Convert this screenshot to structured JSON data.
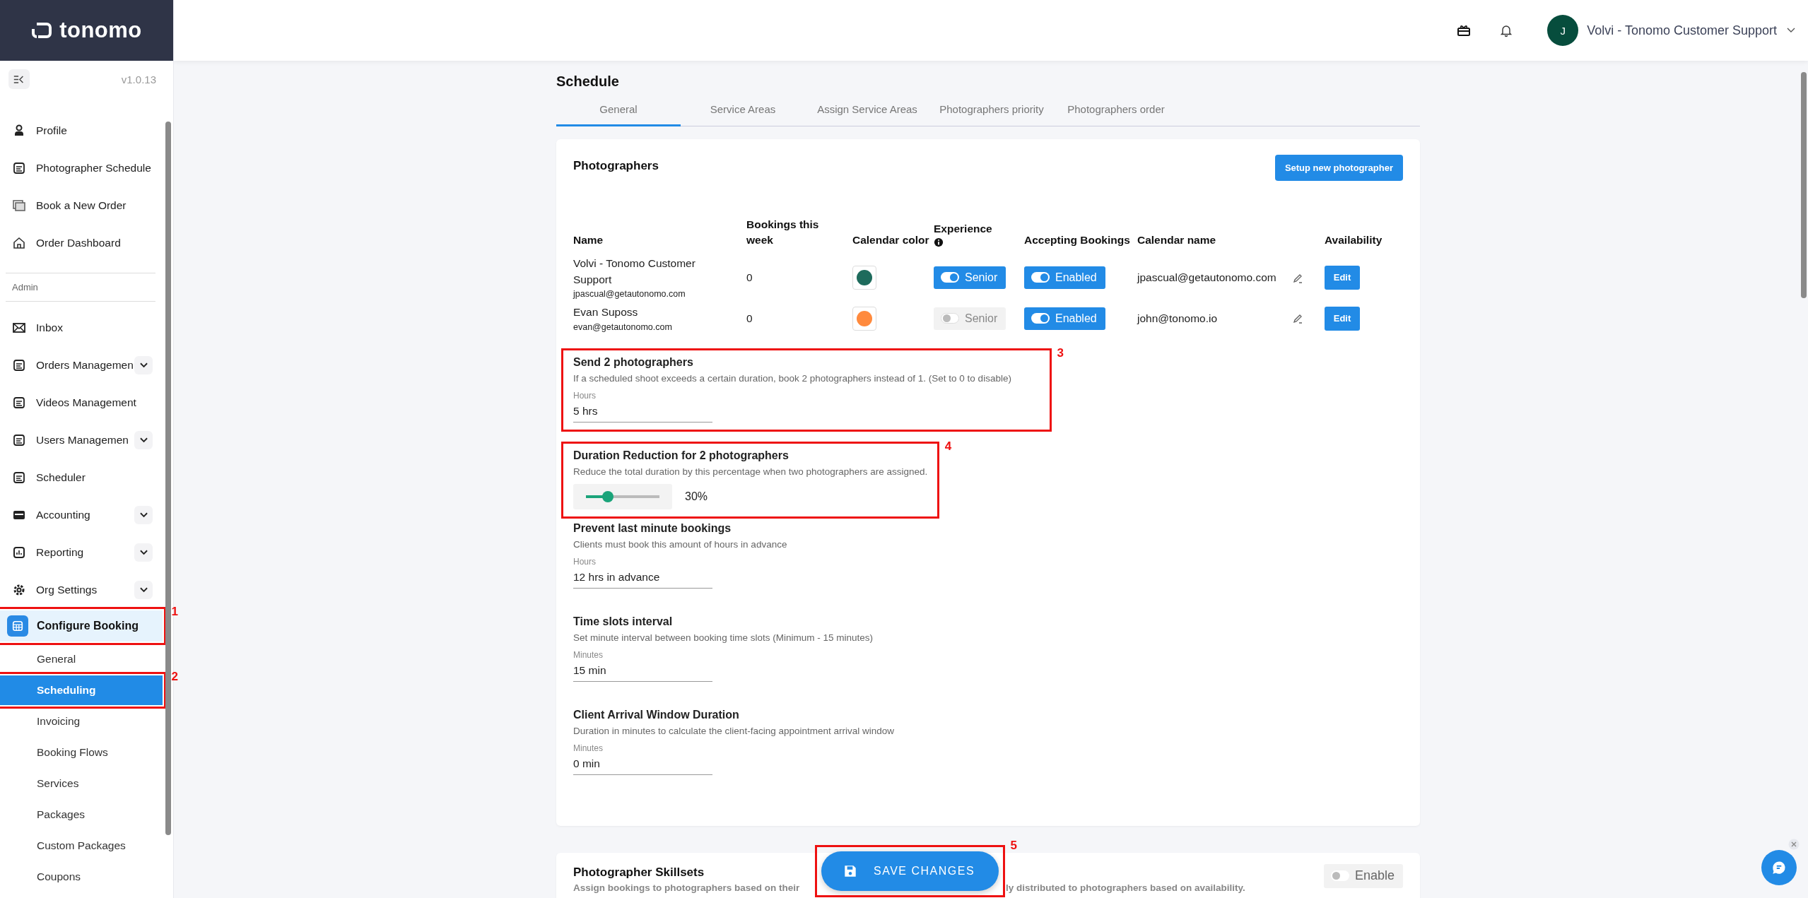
{
  "brand": {
    "name": "tonomo"
  },
  "version": "v1.0.13",
  "sidebar": {
    "items": [
      {
        "label": "Profile",
        "selected": false
      },
      {
        "label": "Photographer Schedule",
        "selected": false
      },
      {
        "label": "Book a New Order",
        "selected": false
      },
      {
        "label": "Order Dashboard",
        "selected": false
      }
    ],
    "section": "Admin",
    "admin_items": [
      {
        "label": "Inbox",
        "selected": false
      },
      {
        "label": "Orders Managemen",
        "selected": false,
        "expanded": false
      },
      {
        "label": "Videos Management",
        "selected": false
      },
      {
        "label": "Users Managemen",
        "selected": false,
        "expanded": false
      },
      {
        "label": "Scheduler",
        "selected": false
      },
      {
        "label": "Accounting",
        "selected": false,
        "expanded": false
      },
      {
        "label": "Reporting",
        "selected": false,
        "expanded": false
      },
      {
        "label": "Org Settings",
        "selected": false,
        "expanded": false
      },
      {
        "label": "Configure Booking",
        "selected": true,
        "annotation": "1",
        "children": [
          {
            "label": "General",
            "selected": false
          },
          {
            "label": "Scheduling",
            "selected": true,
            "annotation": "2"
          },
          {
            "label": "Invoicing",
            "selected": false
          },
          {
            "label": "Booking Flows",
            "selected": false
          },
          {
            "label": "Services",
            "selected": false
          },
          {
            "label": "Packages",
            "selected": false
          },
          {
            "label": "Custom Packages",
            "selected": false
          },
          {
            "label": "Coupons",
            "selected": false
          }
        ]
      }
    ]
  },
  "header": {
    "avatar": "J",
    "user": "Volvi - Tonomo Customer Support"
  },
  "page_title": "Schedule",
  "tabs": [
    {
      "label": "General",
      "selected": true
    },
    {
      "label": "Service Areas",
      "selected": false
    },
    {
      "label": "Assign Service Areas",
      "selected": false
    },
    {
      "label": "Photographers priority",
      "selected": false
    },
    {
      "label": "Photographers order",
      "selected": false
    }
  ],
  "photographers": {
    "title": "Photographers",
    "setup_button": "Setup new photographer",
    "columns": [
      "Name",
      "Bookings this week",
      "Calendar color",
      "Experience",
      "Accepting Bookings",
      "Calendar name",
      "Availability"
    ],
    "rows": [
      {
        "name": "Volvi - Tonomo Customer Support",
        "email": "jpascual@getautonomo.com",
        "bookings": "0",
        "color": "#1e6b5c",
        "experience": {
          "label": "Senior",
          "on": true
        },
        "accepting": {
          "label": "Enabled",
          "on": true
        },
        "calendar_name": "jpascual@getautonomo.com",
        "edit": "Edit"
      },
      {
        "name": "Evan Suposs",
        "email": "evan@getautonomo.com",
        "bookings": "0",
        "color": "#ff8a3d",
        "experience": {
          "label": "Senior",
          "on": false
        },
        "accepting": {
          "label": "Enabled",
          "on": true
        },
        "calendar_name": "john@tonomo.io",
        "edit": "Edit"
      }
    ]
  },
  "settings": [
    {
      "kind": "field",
      "title": "Send 2 photographers",
      "description": "If a scheduled shoot exceeds a certain duration, book 2 photographers instead of 1. (Set to 0 to disable)",
      "label": "Hours",
      "value": "5 hrs",
      "annotation": "3"
    },
    {
      "kind": "slider",
      "title": "Duration Reduction for 2 photographers",
      "description": "Reduce the total duration by this percentage when two photographers are assigned.",
      "level": 0.3,
      "reading": "30%",
      "annotation": "4"
    },
    {
      "kind": "field",
      "title": "Prevent last minute bookings",
      "description": "Clients must book this amount of hours in advance",
      "label": "Hours",
      "value": "12 hrs in advance"
    },
    {
      "kind": "field",
      "title": "Time slots interval",
      "description": "Set minute interval between booking time slots (Minimum - 15 minutes)",
      "label": "Minutes",
      "value": "15 min"
    },
    {
      "kind": "field",
      "title": "Client Arrival Window Duration",
      "description": "Duration in minutes to calculate the client-facing appointment arrival window",
      "label": "Minutes",
      "value": "0 min"
    }
  ],
  "skillsets": {
    "title": "Photographer Skillsets",
    "description_start": "Assign bookings to photographers based on their",
    "description_end": "ly distributed to photographers based on availability.",
    "toggle": {
      "label": "Enable",
      "on": false
    }
  },
  "save_button": {
    "label": "SAVE CHANGES",
    "annotation": "5"
  }
}
